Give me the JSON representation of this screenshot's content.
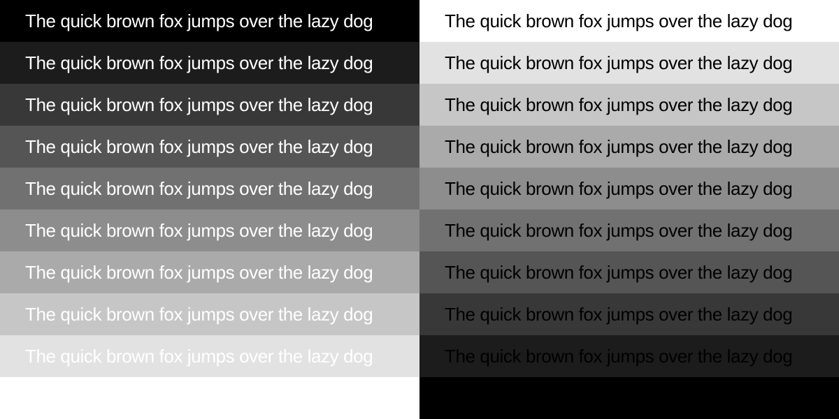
{
  "columns": [
    {
      "id": "left",
      "background": "#ffffff",
      "text_color": "#ffffff",
      "bands": [
        {
          "text": "The quick brown fox jumps over the lazy dog",
          "color": "#000000"
        },
        {
          "text": "The quick brown fox jumps over the lazy dog",
          "color": "#1c1c1c"
        },
        {
          "text": "The quick brown fox jumps over the lazy dog",
          "color": "#383838"
        },
        {
          "text": "The quick brown fox jumps over the lazy dog",
          "color": "#555555"
        },
        {
          "text": "The quick brown fox jumps over the lazy dog",
          "color": "#717171"
        },
        {
          "text": "The quick brown fox jumps over the lazy dog",
          "color": "#8d8d8d"
        },
        {
          "text": "The quick brown fox jumps over the lazy dog",
          "color": "#aaaaaa"
        },
        {
          "text": "The quick brown fox jumps over the lazy dog",
          "color": "#c6c6c6"
        },
        {
          "text": "The quick brown fox jumps over the lazy dog",
          "color": "#e2e2e2"
        }
      ]
    },
    {
      "id": "right",
      "background": "#000000",
      "text_color": "#000000",
      "bands": [
        {
          "text": "The quick brown fox jumps over the lazy dog",
          "color": "#ffffff"
        },
        {
          "text": "The quick brown fox jumps over the lazy dog",
          "color": "#e2e2e2"
        },
        {
          "text": "The quick brown fox jumps over the lazy dog",
          "color": "#c6c6c6"
        },
        {
          "text": "The quick brown fox jumps over the lazy dog",
          "color": "#aaaaaa"
        },
        {
          "text": "The quick brown fox jumps over the lazy dog",
          "color": "#8d8d8d"
        },
        {
          "text": "The quick brown fox jumps over the lazy dog",
          "color": "#717171"
        },
        {
          "text": "The quick brown fox jumps over the lazy dog",
          "color": "#555555"
        },
        {
          "text": "The quick brown fox jumps over the lazy dog",
          "color": "#383838"
        },
        {
          "text": "The quick brown fox jumps over the lazy dog",
          "color": "#1c1c1c"
        }
      ]
    }
  ]
}
